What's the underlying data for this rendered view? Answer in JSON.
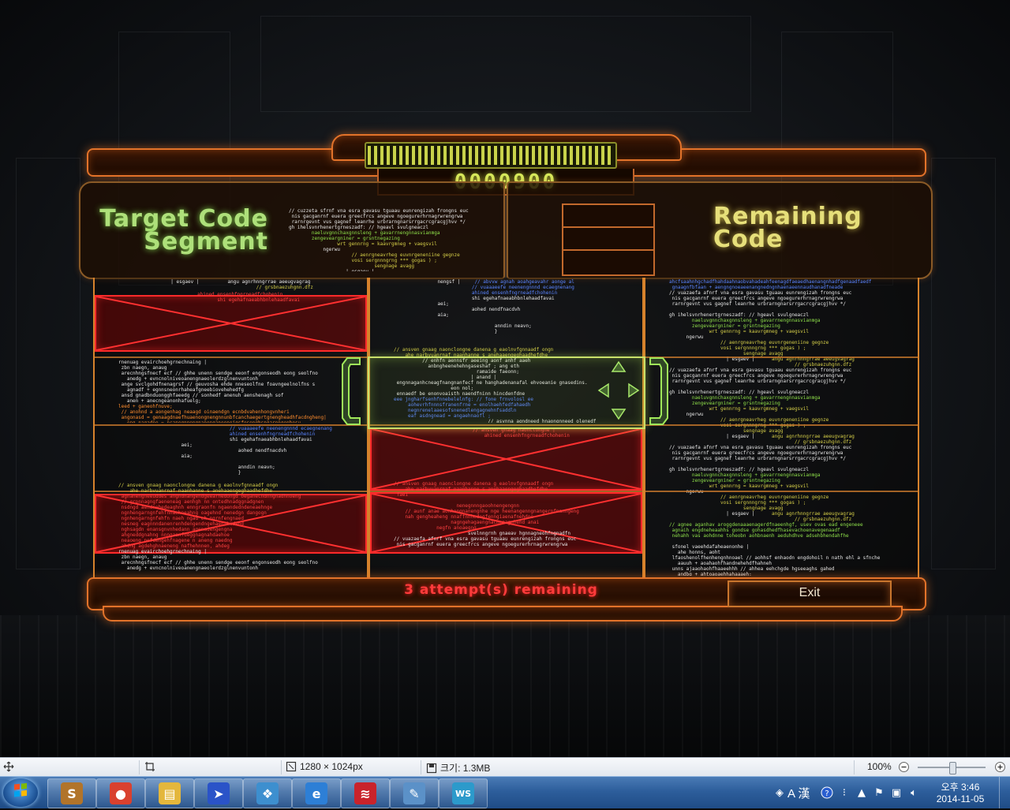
{
  "game": {
    "score": "0000900",
    "progress": 1.0,
    "target_title": [
      "Target Code",
      "Segment"
    ],
    "remaining_title": [
      "Remaining",
      "Code"
    ],
    "attempts_text": "3 attempt(s) remaining",
    "exit_label": "Exit"
  },
  "grid": {
    "columns": [
      {
        "rows": [
          "locked",
          "active",
          "normal",
          "locked"
        ]
      },
      {
        "rows": [
          "normal",
          "active",
          "locked",
          "locked"
        ]
      },
      {
        "rows": [
          "normal",
          "normal",
          "normal",
          "normal"
        ]
      }
    ]
  },
  "colors": {
    "frame_orange": "#e2732a",
    "score_green": "#d6e85a",
    "target_green": "#aee07a",
    "remaining_yellow": "#e6df7a",
    "locked_red": "#ff2a2a",
    "attempts_red": "#ff3b3b"
  },
  "viewer_status": {
    "move_icon": "move-icon",
    "crop_icon": "crop-icon",
    "dimensions": "1280 × 1024px",
    "size": "크기: 1.3MB",
    "zoom": "100%"
  },
  "taskbar": {
    "apps": [
      {
        "name": "slides-app",
        "icon": "S",
        "bg": "#b1742a"
      },
      {
        "name": "chrome",
        "icon": "●",
        "bg": "#d9412f"
      },
      {
        "name": "file-explorer",
        "icon": "▤",
        "bg": "#e4b73c"
      },
      {
        "name": "compass-app",
        "icon": "➤",
        "bg": "#2a53c8"
      },
      {
        "name": "windows-app",
        "icon": "❖",
        "bg": "#3d8fcf"
      },
      {
        "name": "internet-explorer",
        "icon": "e",
        "bg": "#2d7fd6"
      },
      {
        "name": "red-app",
        "icon": "≋",
        "bg": "#c9232b"
      },
      {
        "name": "paint-app",
        "icon": "✎",
        "bg": "#5b91c8"
      },
      {
        "name": "ws-app",
        "icon": "WS",
        "bg": "#2c9acb"
      }
    ],
    "ime": "A 漢",
    "clock_time": "오후 3:46",
    "clock_date": "2014-11-05"
  }
}
